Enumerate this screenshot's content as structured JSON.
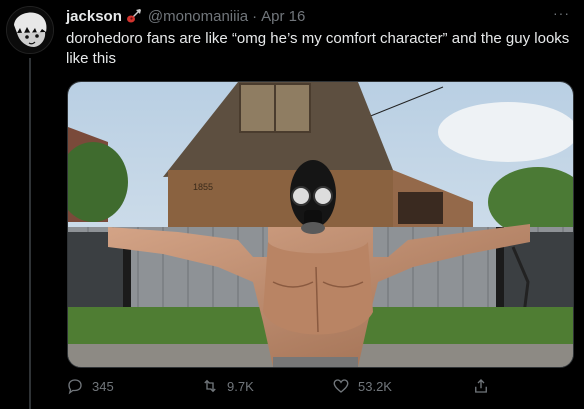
{
  "tweet": {
    "display_name": "jackson",
    "handle": "@monomaniiia",
    "separator": "·",
    "date": "Apr 16",
    "text": "dorohedoro fans are like “omg he’s my comfort character” and the guy looks like this",
    "more_label": "···",
    "media": {
      "alt_description": "",
      "house_sign": "1855"
    },
    "actions": {
      "replies": "345",
      "retweets": "9.7K",
      "likes": "53.2K"
    }
  },
  "icons": {
    "avatar": "anime-avatar",
    "name_badge": "guitar-icon",
    "reply": "reply-icon",
    "retweet": "retweet-icon",
    "like": "heart-icon",
    "share": "share-icon"
  },
  "colors": {
    "background": "#000000",
    "text": "#e7e9ea",
    "muted": "#71767b",
    "divider": "#2f3336"
  }
}
